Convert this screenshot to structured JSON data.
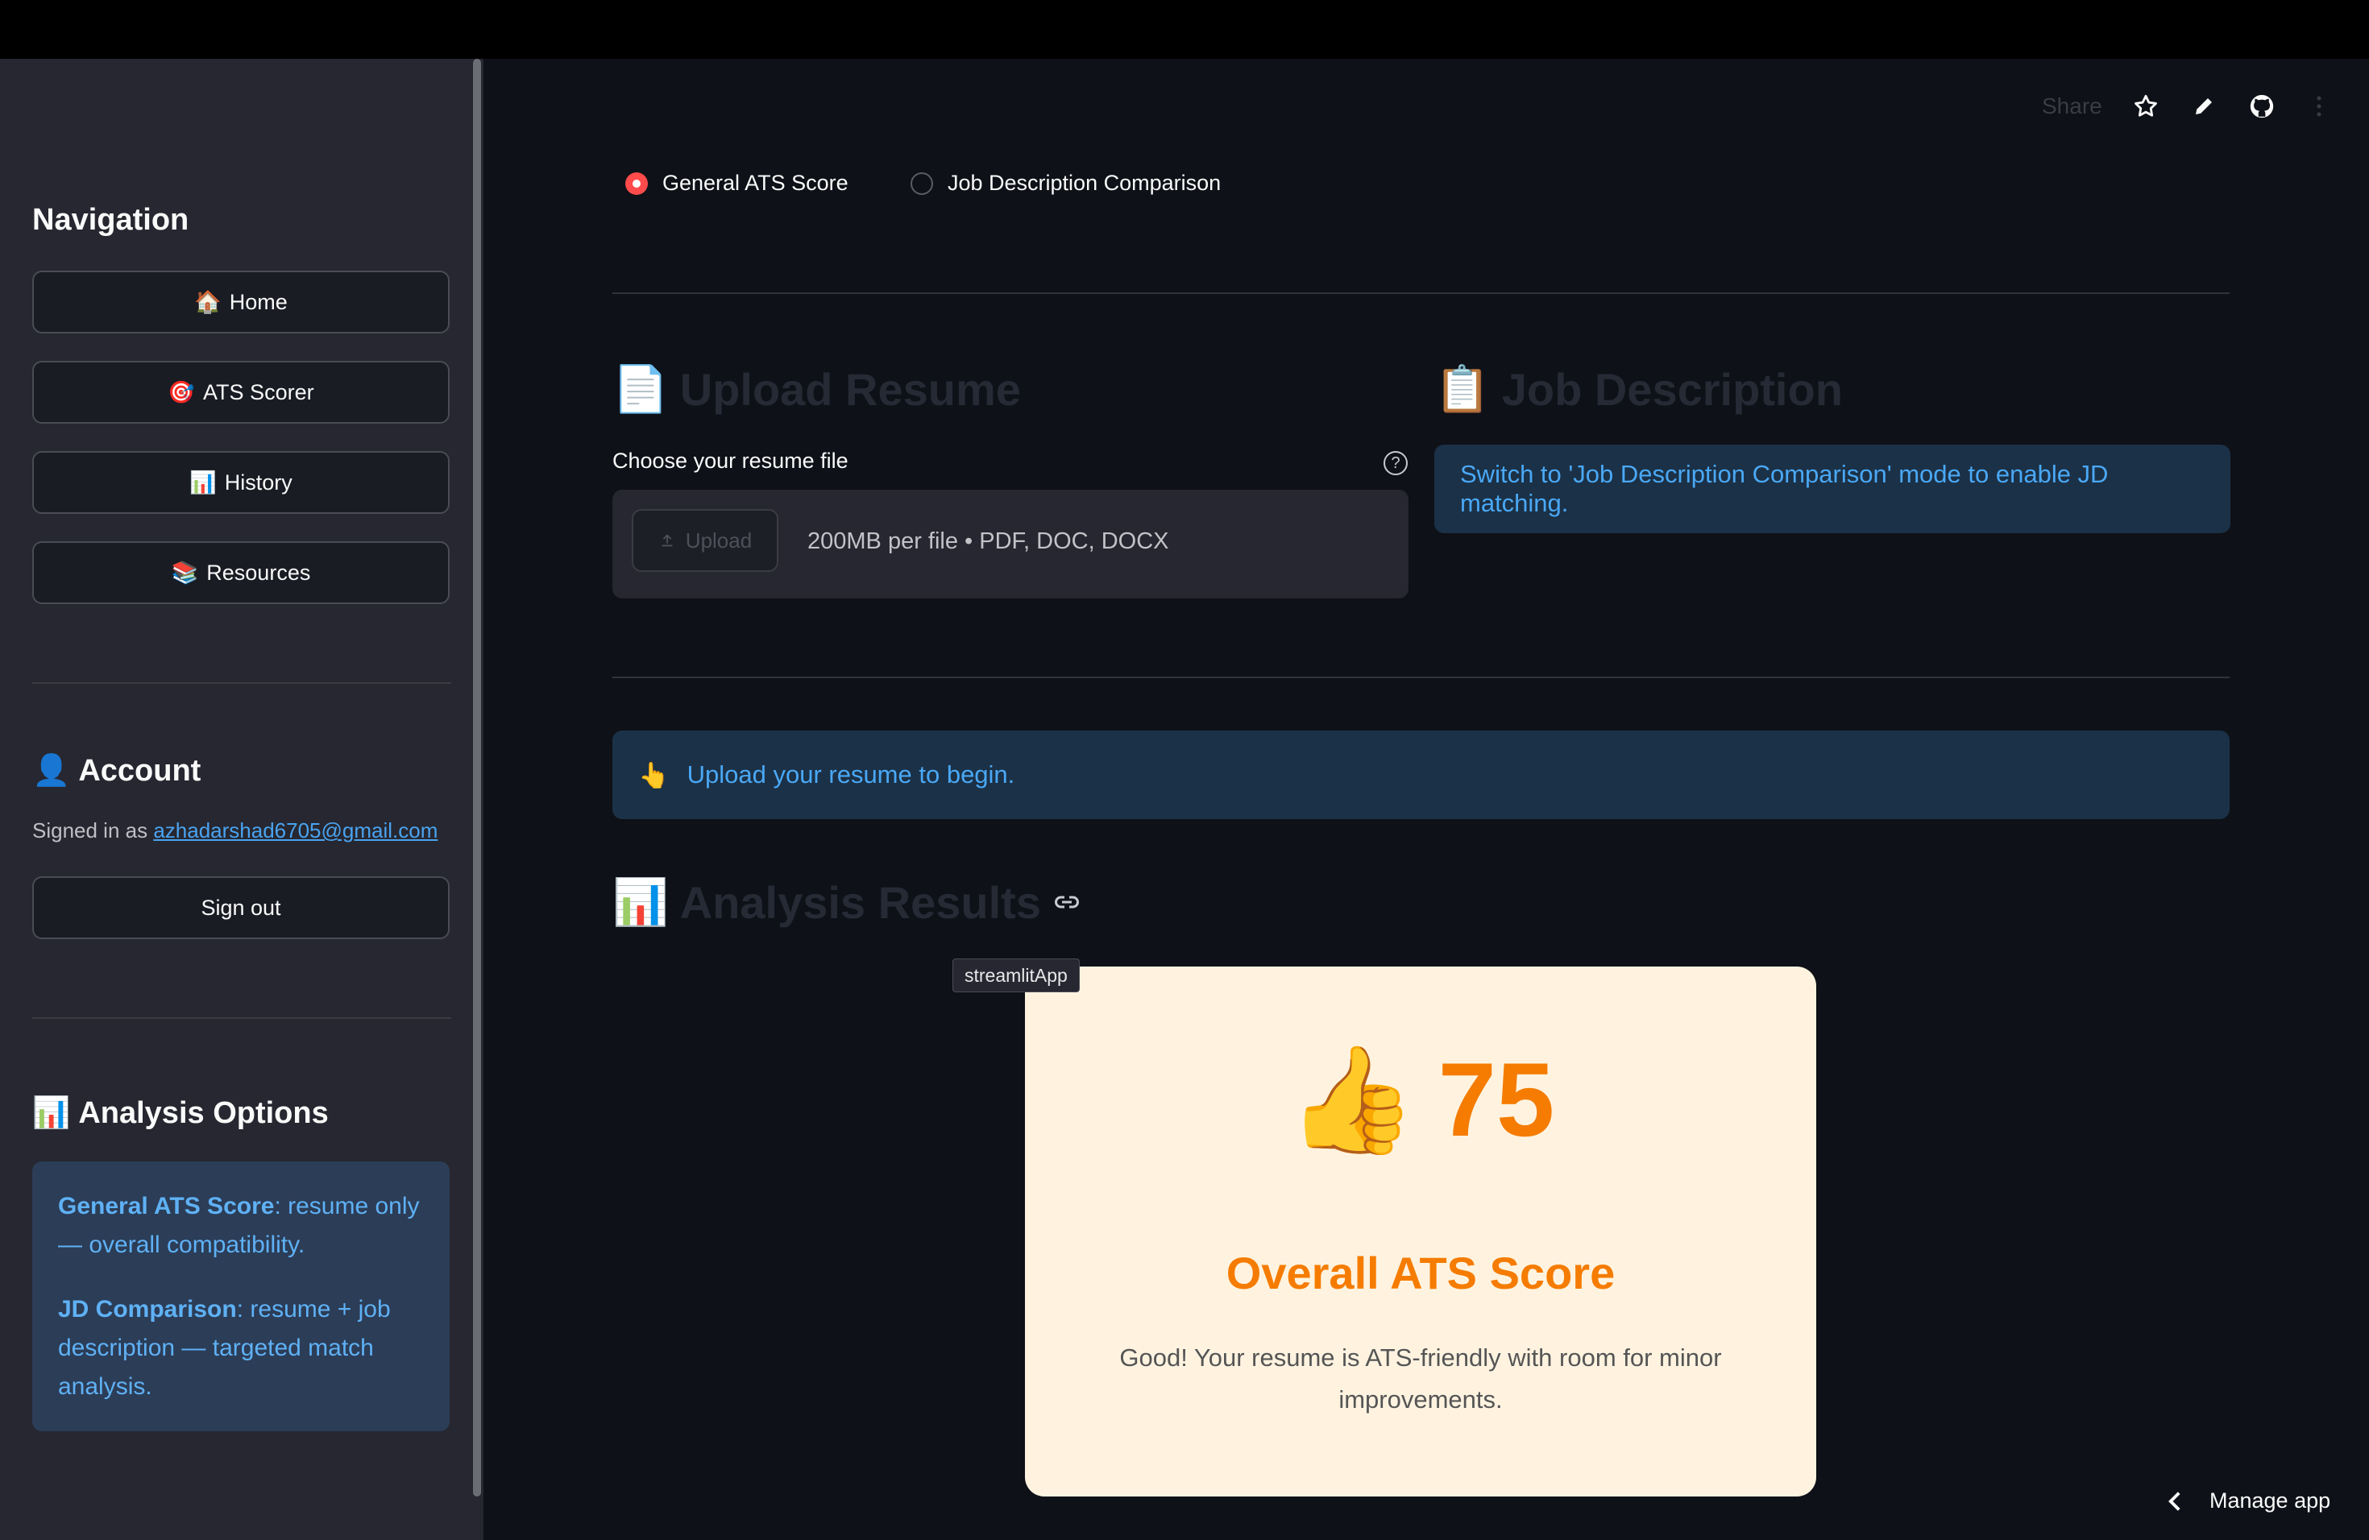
{
  "sidebar": {
    "nav_heading": "Navigation",
    "nav": [
      {
        "icon": "🏠",
        "label": "Home"
      },
      {
        "icon": "🎯",
        "label": "ATS Scorer"
      },
      {
        "icon": "📊",
        "label": "History"
      },
      {
        "icon": "📚",
        "label": "Resources"
      }
    ],
    "account": {
      "icon": "👤",
      "heading": "Account",
      "signed_prefix": "Signed in as ",
      "email": "azhadarshad6705@gmail.com",
      "signout_label": "Sign out"
    },
    "options": {
      "icon": "📊",
      "heading": "Analysis Options",
      "general_bold": "General ATS Score",
      "general_rest": ": resume only — overall compatibility.",
      "jd_bold": "JD Comparison",
      "jd_rest": ": resume + job description — targeted match analysis."
    }
  },
  "toolbar": {
    "share": "Share",
    "icons": [
      "star-icon",
      "pencil-icon",
      "github-icon",
      "kebab-menu-icon"
    ]
  },
  "mode": {
    "options": [
      "General ATS Score",
      "Job Description Comparison"
    ],
    "selected": "General ATS Score"
  },
  "upload": {
    "icon": "📄",
    "title": "Upload Resume",
    "label": "Choose your resume file",
    "button": "Upload",
    "hint": "200MB per file • PDF, DOC, DOCX"
  },
  "jd": {
    "icon": "📋",
    "title": "Job Description",
    "info": "Switch to 'Job Description Comparison' mode to enable JD matching."
  },
  "notice": {
    "icon": "👆",
    "text": "Upload your resume to begin."
  },
  "results": {
    "icon": "📊",
    "title": "Analysis Results",
    "tooltip": "streamlitApp"
  },
  "score_card": {
    "emoji": "👍",
    "score": "75",
    "title": "Overall ATS Score",
    "description": "Good! Your resume is ATS-friendly with room for minor improvements."
  },
  "footer": {
    "manage": "Manage app"
  },
  "colors": {
    "accent": "#ff4b4b",
    "info_text": "#4aa8f5",
    "score": "#f57c00",
    "card_bg": "#fff3e0"
  }
}
